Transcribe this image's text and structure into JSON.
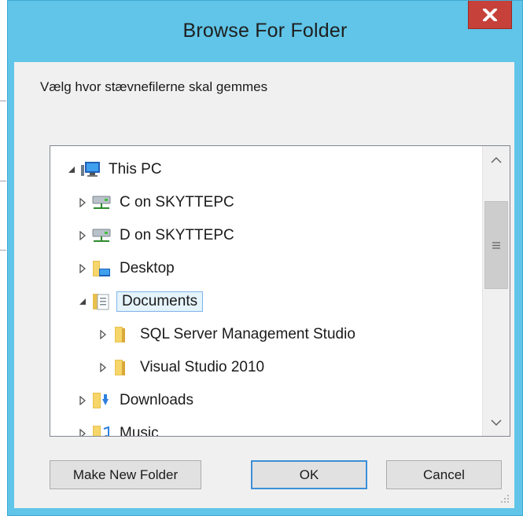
{
  "dialog": {
    "title": "Browse For Folder",
    "close_label": "x",
    "prompt": "Vælg hvor stævnefilerne skal gemmes"
  },
  "tree": {
    "items": [
      {
        "label": "This PC",
        "icon": "computer-icon",
        "expander": "expanded"
      },
      {
        "label": "C on SKYTTEPC",
        "icon": "network-drive-icon",
        "expander": "collapsed"
      },
      {
        "label": "D on SKYTTEPC",
        "icon": "network-drive-icon",
        "expander": "collapsed"
      },
      {
        "label": "Desktop",
        "icon": "desktop-folder-icon",
        "expander": "collapsed"
      },
      {
        "label": "Documents",
        "icon": "documents-folder-icon",
        "expander": "expanded",
        "selected": true
      },
      {
        "label": "SQL Server Management Studio",
        "icon": "folder-icon",
        "expander": "collapsed"
      },
      {
        "label": "Visual Studio 2010",
        "icon": "folder-icon",
        "expander": "collapsed"
      },
      {
        "label": "Downloads",
        "icon": "downloads-folder-icon",
        "expander": "collapsed"
      },
      {
        "label": "Music",
        "icon": "music-folder-icon",
        "expander": "collapsed"
      }
    ]
  },
  "buttons": {
    "make_new_folder": "Make New Folder",
    "ok": "OK",
    "cancel": "Cancel"
  },
  "colors": {
    "titlebar": "#60c5e8",
    "close": "#c6413a",
    "selection_border": "#7eb4ea",
    "selection_fill": "#e5f3fb"
  }
}
